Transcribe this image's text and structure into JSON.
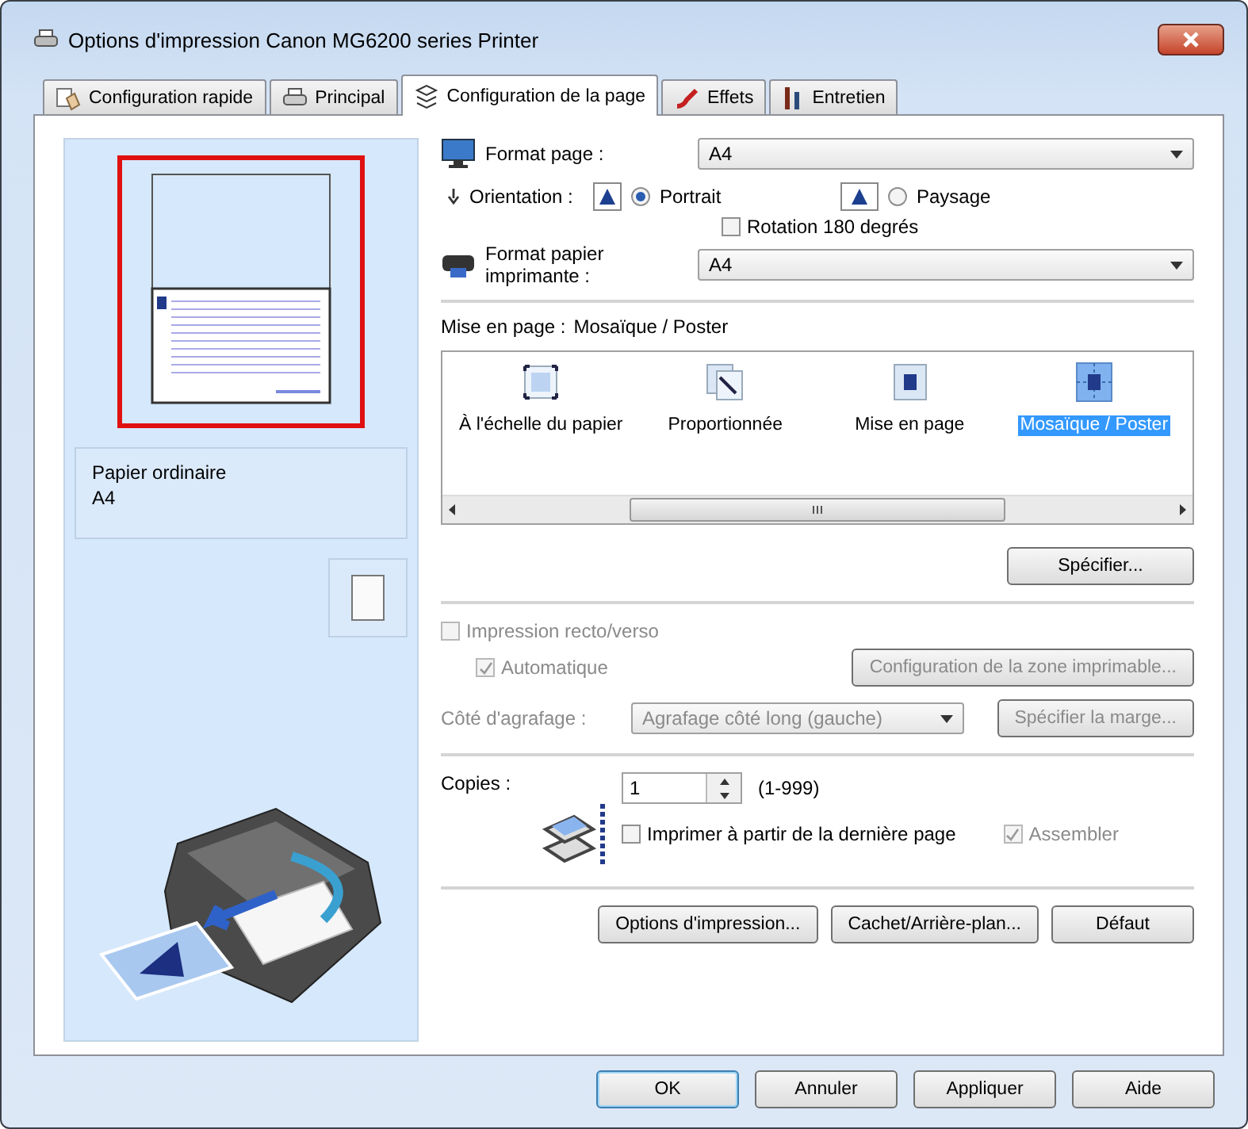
{
  "window": {
    "title": "Options d'impression Canon MG6200 series Printer"
  },
  "tabs": [
    {
      "label": "Configuration rapide",
      "selected": false,
      "kind": "quick"
    },
    {
      "label": "Principal",
      "selected": false,
      "kind": "main"
    },
    {
      "label": "Configuration de la page",
      "selected": true,
      "kind": "page"
    },
    {
      "label": "Effets",
      "selected": false,
      "kind": "effects"
    },
    {
      "label": "Entretien",
      "selected": false,
      "kind": "maintenance"
    }
  ],
  "preview": {
    "paper_type": "Papier ordinaire",
    "paper_size": "A4"
  },
  "page_size": {
    "label": "Format page :",
    "value": "A4"
  },
  "orientation": {
    "label": "Orientation :",
    "options": [
      {
        "label": "Portrait",
        "selected": true
      },
      {
        "label": "Paysage",
        "selected": false
      }
    ]
  },
  "rotate_180": {
    "label": "Rotation 180 degrés",
    "checked": false
  },
  "printer_paper_size": {
    "label": "Format papier imprimante :",
    "value": "A4"
  },
  "layout": {
    "label": "Mise en page :",
    "value": "Mosaïque / Poster",
    "items": [
      {
        "label": "À l'échelle du papier",
        "selected": false,
        "kind": "fit"
      },
      {
        "label": "Proportionnée",
        "selected": false,
        "kind": "scaled"
      },
      {
        "label": "Mise en page",
        "selected": false,
        "kind": "layout"
      },
      {
        "label": "Mosaïque / Poster",
        "selected": true,
        "kind": "tiling"
      }
    ]
  },
  "specify_button": {
    "label": "Spécifier...",
    "disabled": false
  },
  "duplex": {
    "label": "Impression recto/verso",
    "checked": false,
    "disabled": true
  },
  "automatic": {
    "label": "Automatique",
    "checked": true,
    "disabled": true
  },
  "print_area_button": {
    "label": "Configuration de la zone imprimable...",
    "disabled": true
  },
  "stapling": {
    "label": "Côté d'agrafage :",
    "value": "Agrafage côté long (gauche)",
    "disabled": true
  },
  "margin_button": {
    "label": "Spécifier la marge...",
    "disabled": true
  },
  "copies": {
    "label": "Copies :",
    "value": "1",
    "range": "(1-999)"
  },
  "reverse_order": {
    "label": "Imprimer à partir de la dernière page",
    "checked": false,
    "disabled": false
  },
  "collate": {
    "label": "Assembler",
    "checked": true,
    "disabled": true
  },
  "page_buttons": [
    {
      "label": "Options d'impression..."
    },
    {
      "label": "Cachet/Arrière-plan..."
    },
    {
      "label": "Défaut"
    }
  ],
  "dialog_buttons": [
    {
      "label": "OK",
      "default": true
    },
    {
      "label": "Annuler",
      "default": false
    },
    {
      "label": "Appliquer",
      "default": false
    },
    {
      "label": "Aide",
      "default": false
    }
  ]
}
